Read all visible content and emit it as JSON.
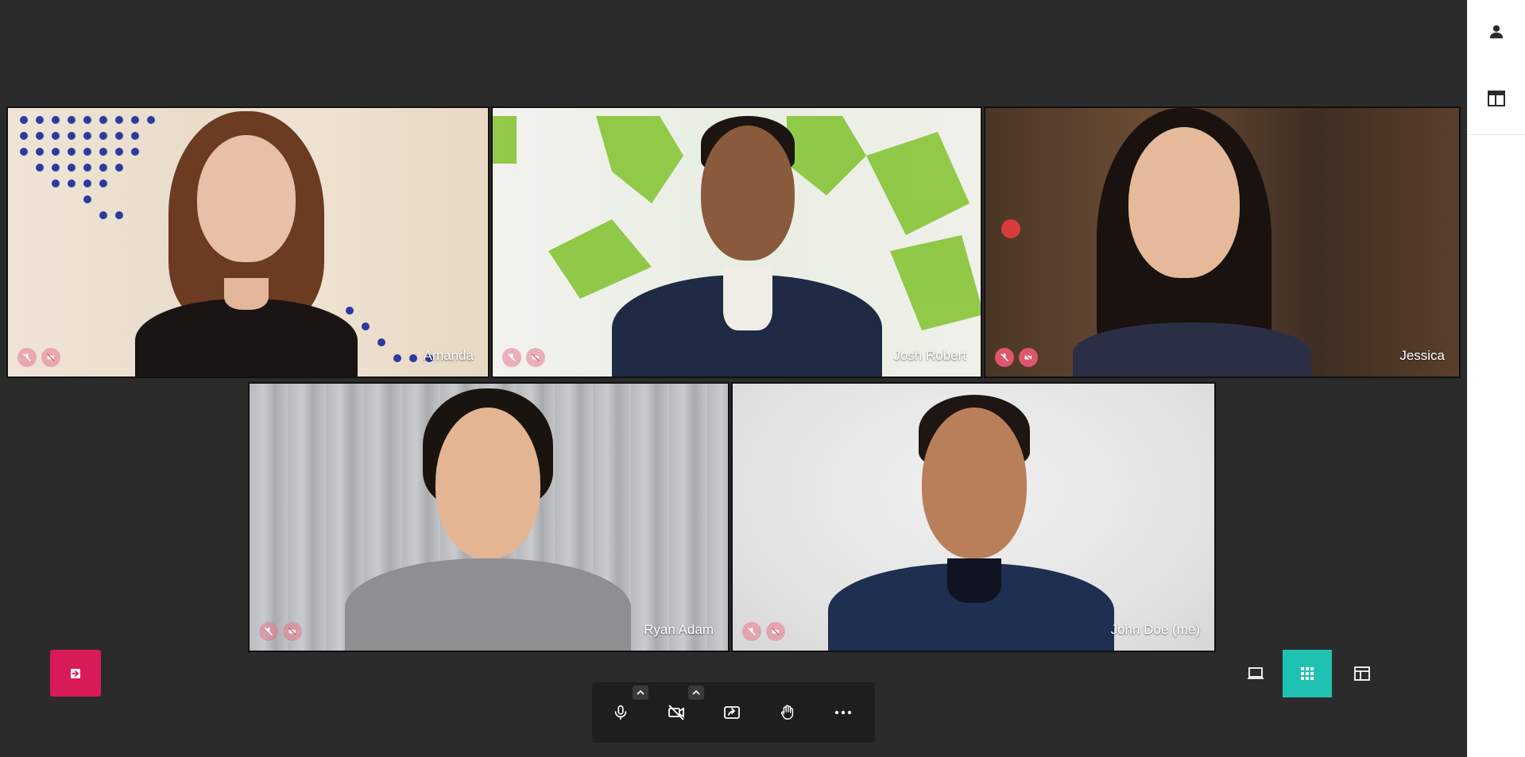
{
  "participants": [
    {
      "name": "Amanda",
      "mic_muted": true,
      "cam_off": true,
      "icons_style": "faded"
    },
    {
      "name": "Josh Robert",
      "mic_muted": true,
      "cam_off": true,
      "icons_style": "faded"
    },
    {
      "name": "Jessica",
      "mic_muted": true,
      "cam_off": true,
      "icons_style": "strong"
    },
    {
      "name": "Ryan Adam",
      "mic_muted": true,
      "cam_off": true,
      "icons_style": "faded"
    },
    {
      "name": "John Doe (me)",
      "mic_muted": true,
      "cam_off": true,
      "icons_style": "faded"
    }
  ],
  "controls": {
    "leave_icon": "leave-meeting-icon",
    "toolbar": [
      "microphone-icon",
      "camera-off-icon",
      "share-screen-icon",
      "raise-hand-icon",
      "more-options-icon"
    ],
    "layouts": [
      "presentation-layout-icon",
      "grid-layout-icon",
      "sidebar-layout-icon"
    ],
    "active_layout": "grid-layout-icon"
  },
  "rail": {
    "icons": [
      "participants-icon",
      "layout-panel-icon"
    ]
  },
  "colors": {
    "stage": "#2b2b2b",
    "leave": "#d81b56",
    "active_layout": "#1fc2b2",
    "toolbar": "#1e1e1e"
  }
}
